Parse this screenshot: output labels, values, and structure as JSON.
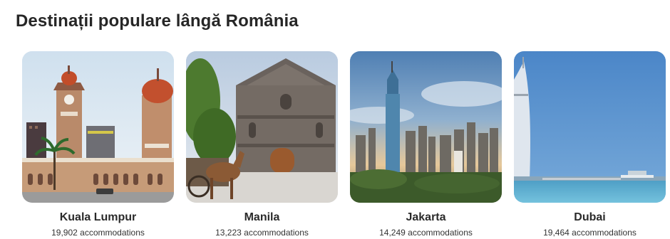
{
  "section": {
    "title": "Destinații populare lângă România"
  },
  "destinations": [
    {
      "name": "Kuala Lumpur",
      "count": "19,902 accommodations"
    },
    {
      "name": "Manila",
      "count": "13,223 accommodations"
    },
    {
      "name": "Jakarta",
      "count": "14,249 accommodations"
    },
    {
      "name": "Dubai",
      "count": "19,464 accommodations"
    }
  ]
}
